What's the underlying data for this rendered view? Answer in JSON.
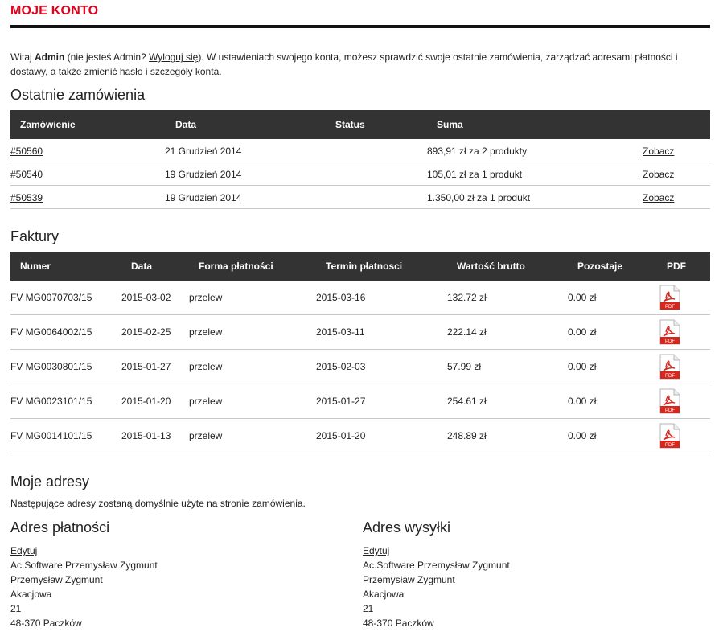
{
  "page": {
    "title": "MOJE KONTO"
  },
  "intro": {
    "greeting_prefix": "Witaj ",
    "user": "Admin",
    "not_you_prefix": " (nie jesteś Admin? ",
    "logout_link": "Wyloguj się",
    "text_middle": "). W ustawieniach swojego konta, możesz sprawdzić swoje ostatnie zamówienia, zarządzać adresami płatności i dostawy, a także ",
    "change_password_link": "zmienić hasło i szczegóły konta",
    "text_end": "."
  },
  "orders": {
    "heading": "Ostatnie zamówienia",
    "columns": [
      "Zamówienie",
      "Data",
      "Status",
      "Suma"
    ],
    "rows": [
      {
        "id": "#50560",
        "date": "21 Grudzień 2014",
        "status": "",
        "total": "893,91 zł za 2 produkty",
        "action": "Zobacz"
      },
      {
        "id": "#50540",
        "date": "19 Grudzień 2014",
        "status": "",
        "total": "105,01 zł za 1 produkt",
        "action": "Zobacz"
      },
      {
        "id": "#50539",
        "date": "19 Grudzień 2014",
        "status": "",
        "total": "1.350,00 zł za 1 produkt",
        "action": "Zobacz"
      }
    ]
  },
  "invoices": {
    "heading": "Faktury",
    "columns": [
      "Numer",
      "Data",
      "Forma płatności",
      "Termin płatnosci",
      "Wartość brutto",
      "Pozostaje",
      "PDF"
    ],
    "pdf_label": "PDF",
    "rows": [
      {
        "number": "FV MG0070703/15",
        "date": "2015-03-02",
        "payment": "przelew",
        "due": "2015-03-16",
        "gross": "132.72 zł",
        "remaining": "0.00 zł"
      },
      {
        "number": "FV MG0064002/15",
        "date": "2015-02-25",
        "payment": "przelew",
        "due": "2015-03-11",
        "gross": "222.14 zł",
        "remaining": "0.00 zł"
      },
      {
        "number": "FV MG0030801/15",
        "date": "2015-01-27",
        "payment": "przelew",
        "due": "2015-02-03",
        "gross": "57.99 zł",
        "remaining": "0.00 zł"
      },
      {
        "number": "FV MG0023101/15",
        "date": "2015-01-20",
        "payment": "przelew",
        "due": "2015-01-27",
        "gross": "254.61 zł",
        "remaining": "0.00 zł"
      },
      {
        "number": "FV MG0014101/15",
        "date": "2015-01-13",
        "payment": "przelew",
        "due": "2015-01-20",
        "gross": "248.89 zł",
        "remaining": "0.00 zł"
      }
    ]
  },
  "addresses": {
    "heading": "Moje adresy",
    "note": "Następujące adresy zostaną domyślnie użyte na stronie zamówienia.",
    "billing": {
      "title": "Adres płatności",
      "edit": "Edytuj",
      "lines": [
        "Ac.Software Przemysław Zygmunt",
        "Przemysław Zygmunt",
        "Akacjowa",
        "21",
        "48-370 Paczków"
      ]
    },
    "shipping": {
      "title": "Adres wysyłki",
      "edit": "Edytuj",
      "lines": [
        "Ac.Software Przemysław Zygmunt",
        "Przemysław Zygmunt",
        "Akacjowa",
        "21",
        "48-370 Paczków"
      ]
    }
  },
  "colors": {
    "accent": "#e2001a",
    "table_header": "#333333",
    "pdf_red": "#d9261c"
  }
}
